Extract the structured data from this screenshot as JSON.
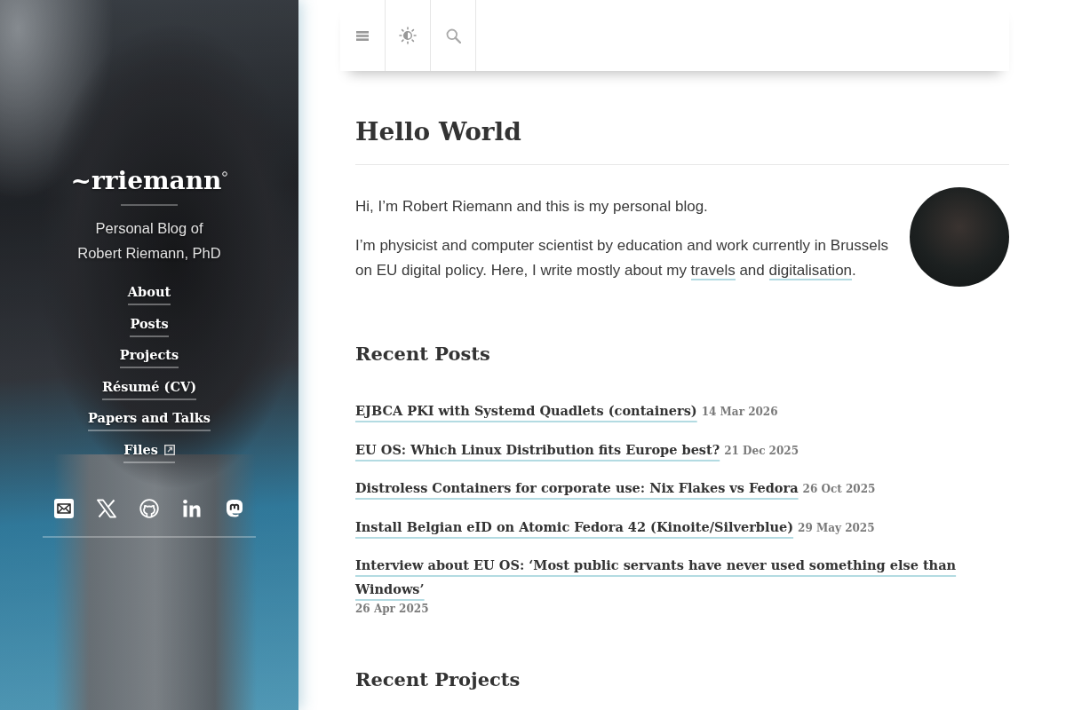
{
  "sidebar": {
    "title": "~rriemann",
    "subtitle": "Personal Blog of Robert Riemann, PhD",
    "nav": [
      {
        "label": "About",
        "external": false
      },
      {
        "label": "Posts",
        "external": false
      },
      {
        "label": "Projects",
        "external": false
      },
      {
        "label": "Résumé (CV)",
        "external": false
      },
      {
        "label": "Papers and Talks",
        "external": false
      },
      {
        "label": "Files",
        "external": true
      }
    ]
  },
  "post": {
    "title": "Hello World",
    "paragraphs": [
      {
        "segments": [
          {
            "kind": "text",
            "text": "Hi, I’m Robert Riemann and this is my personal blog."
          }
        ]
      },
      {
        "segments": [
          {
            "kind": "text",
            "text": "I’m physicist and computer scientist by education and work currently in Brussels on EU digital policy. Here, I write mostly about my "
          },
          {
            "kind": "link",
            "text": "travels"
          },
          {
            "kind": "text",
            "text": " and "
          },
          {
            "kind": "link",
            "text": "digitalisation"
          },
          {
            "kind": "text",
            "text": "."
          }
        ]
      }
    ]
  },
  "recent_posts": {
    "heading": "Recent Posts",
    "items": [
      {
        "title": "EJBCA PKI with Systemd Quadlets (containers)",
        "date": "14 Mar 2026"
      },
      {
        "title": "EU OS: Which Linux Distribution fits Europe best?",
        "date": "21 Dec 2025"
      },
      {
        "title": "Distroless Containers for corporate use: Nix Flakes vs Fedora",
        "date": "26 Oct 2025"
      },
      {
        "title": "Install Belgian eID on Atomic Fedora 42 (Kinoite/Silverblue)",
        "date": "29 May 2025"
      },
      {
        "title": "Interview about EU OS: ‘Most public servants have never used something else than Windows’",
        "date": "26 Apr 2025"
      }
    ]
  },
  "recent_projects": {
    "heading": "Recent Projects"
  }
}
